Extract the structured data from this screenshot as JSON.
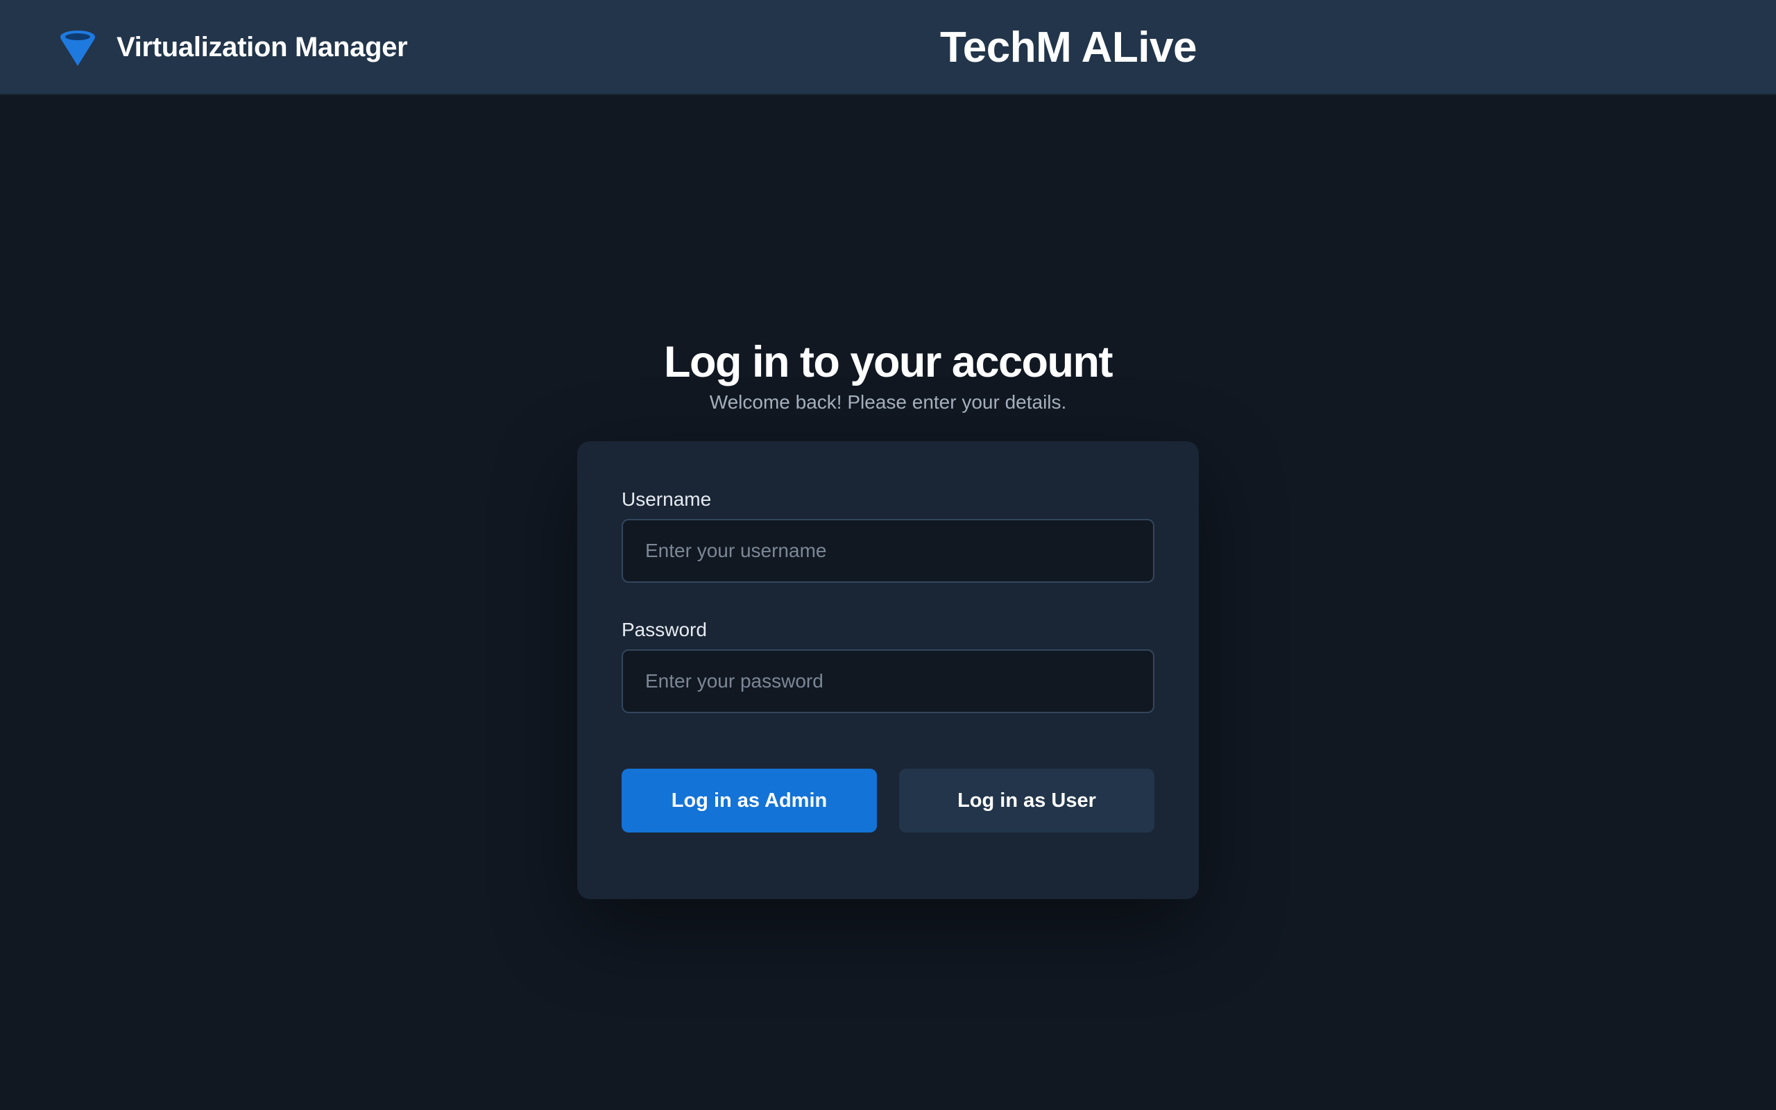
{
  "header": {
    "brand_name": "Virtualization Manager",
    "logo_icon": "funnel-icon",
    "center_title": "TechM ALive"
  },
  "login": {
    "title": "Log in to your account",
    "subtitle": "Welcome back! Please enter your details.",
    "username": {
      "label": "Username",
      "placeholder": "Enter your username",
      "value": ""
    },
    "password": {
      "label": "Password",
      "placeholder": "Enter your password",
      "value": ""
    },
    "admin_button_label": "Log in as Admin",
    "user_button_label": "Log in as User"
  },
  "colors": {
    "background": "#111822",
    "header": "#22354a",
    "card": "#1a2635",
    "accent": "#1473d6",
    "secondary_button": "#22354a",
    "muted_text": "#a9b3c0"
  }
}
